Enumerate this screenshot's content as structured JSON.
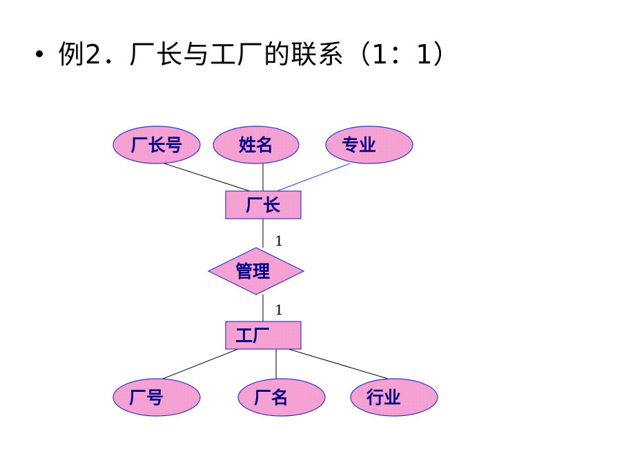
{
  "title": "例2．厂长与工厂的联系（1：1）",
  "colors": {
    "shape_fill": "#f39ad0",
    "shape_stroke": "#3333cc",
    "text": "#000080",
    "line_black": "#000000",
    "line_blue": "#3333ff"
  },
  "diagram": {
    "entities": [
      {
        "id": "director",
        "label": "厂长"
      },
      {
        "id": "factory",
        "label": "工厂"
      }
    ],
    "relationship": {
      "id": "manage",
      "label": "管理"
    },
    "cardinalities": {
      "director_side": "1",
      "factory_side": "1"
    },
    "director_attributes": [
      {
        "label": "厂长号"
      },
      {
        "label": "姓名"
      },
      {
        "label": "专业"
      }
    ],
    "factory_attributes": [
      {
        "label": "厂号"
      },
      {
        "label": "厂名"
      },
      {
        "label": "行业"
      }
    ]
  }
}
